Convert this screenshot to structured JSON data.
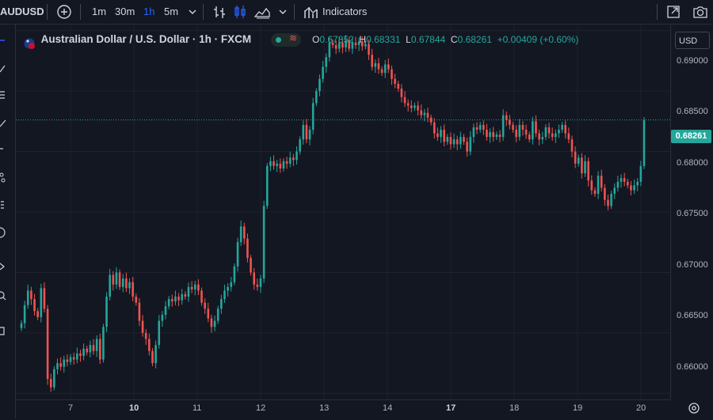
{
  "toolbar": {
    "symbol": "AUDUSD",
    "timeframes": [
      "1m",
      "30m",
      "1h",
      "5m"
    ],
    "active_timeframe": "1h",
    "indicators_label": "Indicators"
  },
  "legend": {
    "pair_title": "Australian Dollar / U.S. Dollar · 1h · FXCM",
    "open_key": "O",
    "open_val": "0.67852",
    "high_key": "H",
    "high_val": "0.68331",
    "low_key": "L",
    "low_val": "0.67844",
    "close_key": "C",
    "close_val": "0.68261",
    "change": "+0.00409 (+0.60%)"
  },
  "axis": {
    "currency": "USD",
    "y_ticks": [
      "0.69000",
      "0.68500",
      "0.68000",
      "0.67500",
      "0.67000",
      "0.66500",
      "0.66000"
    ],
    "x_ticks": [
      "7",
      "10",
      "11",
      "12",
      "13",
      "14",
      "17",
      "18",
      "19",
      "20"
    ],
    "last_price": "0.68261"
  },
  "colors": {
    "up": "#26a69a",
    "down": "#ef5350",
    "background": "#131722"
  },
  "chart_data": {
    "type": "candlestick",
    "title": "Australian Dollar / U.S. Dollar · 1h · FXCM",
    "ylim": [
      0.6595,
      0.6905
    ],
    "last_close": 0.68261,
    "x_day_labels": [
      "7",
      "10",
      "11",
      "12",
      "13",
      "14",
      "17",
      "18",
      "19",
      "20"
    ],
    "closes": [
      0.6658,
      0.6673,
      0.6685,
      0.6678,
      0.6668,
      0.6663,
      0.6687,
      0.667,
      0.6612,
      0.6605,
      0.662,
      0.6625,
      0.6622,
      0.6628,
      0.6626,
      0.663,
      0.6628,
      0.6633,
      0.6631,
      0.6637,
      0.6634,
      0.664,
      0.6635,
      0.6645,
      0.6628,
      0.6655,
      0.668,
      0.6698,
      0.669,
      0.67,
      0.6688,
      0.6695,
      0.6687,
      0.6692,
      0.668,
      0.6675,
      0.666,
      0.665,
      0.6645,
      0.6635,
      0.6625,
      0.664,
      0.666,
      0.6665,
      0.6672,
      0.6678,
      0.6676,
      0.668,
      0.6677,
      0.6682,
      0.668,
      0.6688,
      0.6686,
      0.669,
      0.6685,
      0.6675,
      0.667,
      0.6662,
      0.6655,
      0.666,
      0.667,
      0.6678,
      0.6685,
      0.6688,
      0.6692,
      0.6705,
      0.6725,
      0.6738,
      0.6728,
      0.6712,
      0.67,
      0.669,
      0.6688,
      0.6695,
      0.6755,
      0.6788,
      0.6792,
      0.6788,
      0.679,
      0.6786,
      0.6792,
      0.679,
      0.6795,
      0.6793,
      0.68,
      0.681,
      0.6822,
      0.681,
      0.6818,
      0.684,
      0.685,
      0.686,
      0.687,
      0.6878,
      0.689,
      0.6888,
      0.6885,
      0.689,
      0.6886,
      0.6892,
      0.6885,
      0.689,
      0.6888,
      0.6891,
      0.6887,
      0.6889,
      0.688,
      0.687,
      0.6873,
      0.6868,
      0.6865,
      0.6872,
      0.6868,
      0.686,
      0.6856,
      0.6852,
      0.6845,
      0.684,
      0.6838,
      0.6836,
      0.6838,
      0.6834,
      0.683,
      0.6832,
      0.6828,
      0.6824,
      0.6815,
      0.6812,
      0.6818,
      0.6808,
      0.6812,
      0.6806,
      0.681,
      0.6806,
      0.6812,
      0.6808,
      0.68,
      0.6812,
      0.682,
      0.6818,
      0.6822,
      0.6818,
      0.6812,
      0.6816,
      0.6812,
      0.6814,
      0.6812,
      0.683,
      0.6826,
      0.6822,
      0.6818,
      0.6812,
      0.6822,
      0.6818,
      0.6814,
      0.681,
      0.6825,
      0.6815,
      0.681,
      0.6812,
      0.682,
      0.6815,
      0.6812,
      0.6815,
      0.6818,
      0.6822,
      0.6815,
      0.681,
      0.68,
      0.679,
      0.6795,
      0.6782,
      0.6792,
      0.6776,
      0.6768,
      0.6765,
      0.678,
      0.677,
      0.676,
      0.6755,
      0.6765,
      0.677,
      0.6775,
      0.6778,
      0.6775,
      0.6772,
      0.6768,
      0.6772,
      0.6775,
      0.6788,
      0.6826
    ]
  }
}
